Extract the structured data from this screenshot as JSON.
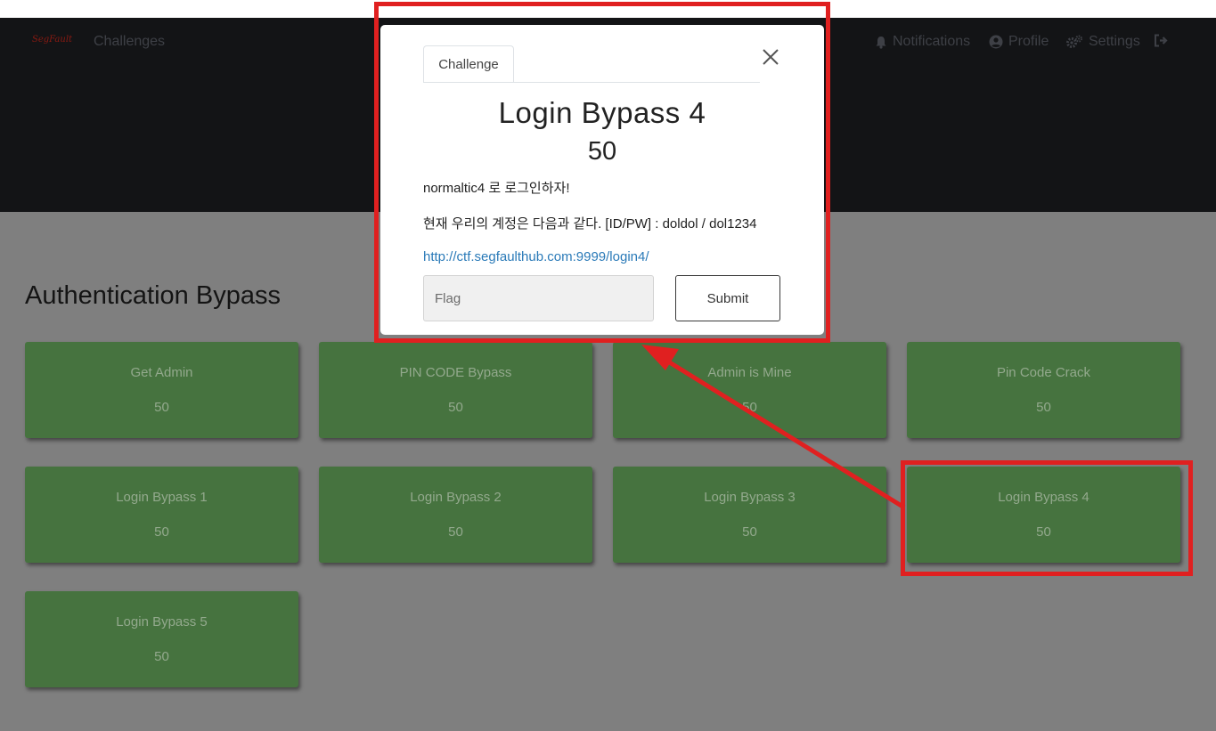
{
  "navbar": {
    "brand": "SegFault",
    "challenges_label": "Challenges",
    "notifications_label": "Notifications",
    "profile_label": "Profile",
    "settings_label": "Settings"
  },
  "category": {
    "title": "Authentication Bypass",
    "challenges": [
      {
        "name": "Get Admin",
        "value": "50"
      },
      {
        "name": "PIN CODE Bypass",
        "value": "50"
      },
      {
        "name": "Admin is Mine",
        "value": "50"
      },
      {
        "name": "Pin Code Crack",
        "value": "50"
      },
      {
        "name": "Login Bypass 1",
        "value": "50"
      },
      {
        "name": "Login Bypass 2",
        "value": "50"
      },
      {
        "name": "Login Bypass 3",
        "value": "50"
      },
      {
        "name": "Login Bypass 4",
        "value": "50"
      },
      {
        "name": "Login Bypass 5",
        "value": "50"
      }
    ]
  },
  "modal": {
    "tab_label": "Challenge",
    "title": "Login Bypass 4",
    "value": "50",
    "description_line1": "normaltic4 로 로그인하자!",
    "description_line2": "현재 우리의 계정은 다음과 같다. [ID/PW] : doldol / dol1234",
    "link": "http://ctf.segfaulthub.com:9999/login4/",
    "flag_placeholder": "Flag",
    "submit_label": "Submit"
  },
  "colors": {
    "card_green": "#46733f",
    "annotation_red": "#e02020",
    "link_blue": "#2a7ab8"
  }
}
